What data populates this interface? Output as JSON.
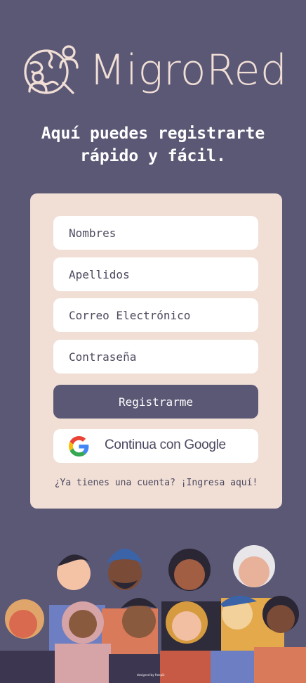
{
  "brand": {
    "name": "MigroRed",
    "logo_icon": "globe-people-logo"
  },
  "tagline": {
    "line1": "Aquí puedes registrarte",
    "line2": "rápido y fácil."
  },
  "form": {
    "first_name_placeholder": "Nombres",
    "last_name_placeholder": "Apellidos",
    "email_placeholder": "Correo Electrónico",
    "password_placeholder": "Contraseña",
    "register_label": "Registrarme",
    "google_label": "Continua con Google",
    "google_icon": "google-g-icon",
    "account_prompt": "¿Ya tienes una cuenta?",
    "login_link": "¡Ingresa aquí!"
  },
  "footer": {
    "credit": "designed by freepik"
  },
  "colors": {
    "background": "#5b5876",
    "card": "#f1dfd6",
    "brand_text": "#f1dfd6",
    "button": "#5b5876"
  }
}
